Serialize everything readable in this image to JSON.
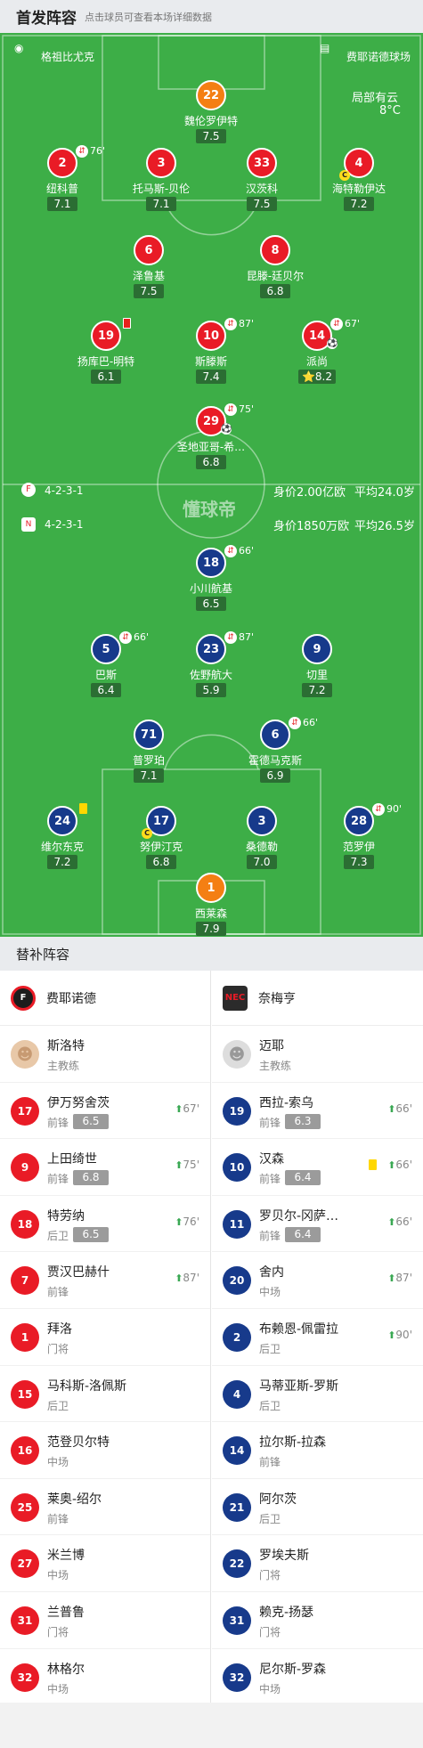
{
  "header": {
    "title": "首发阵容",
    "subtitle": "点击球员可查看本场详细数据"
  },
  "match": {
    "referee": "格祖比尤克",
    "stadium": "费耶诺德球场",
    "weather": "局部有云",
    "temperature": "8°C",
    "watermark": "懂球帝"
  },
  "home_team": {
    "name": "费耶诺德",
    "formation": "4-2-3-1",
    "value": "身价2.00亿欧",
    "avg_age": "平均24.0岁"
  },
  "away_team": {
    "name": "奈梅亨",
    "formation": "4-2-3-1",
    "value": "身价1850万欧",
    "avg_age": "平均26.5岁"
  },
  "home_players": [
    {
      "num": "22",
      "name": "魏伦罗伊特",
      "rating": "7.5",
      "color": "orange"
    },
    {
      "num": "2",
      "name": "纽科普",
      "rating": "7.1",
      "color": "red",
      "sub_min": "76'"
    },
    {
      "num": "3",
      "name": "托马斯-贝伦",
      "rating": "7.1",
      "color": "red"
    },
    {
      "num": "33",
      "name": "汉茨科",
      "rating": "7.5",
      "color": "red"
    },
    {
      "num": "4",
      "name": "海特勒伊达",
      "rating": "7.2",
      "color": "red",
      "captain": "C"
    },
    {
      "num": "6",
      "name": "泽鲁基",
      "rating": "7.5",
      "color": "red"
    },
    {
      "num": "8",
      "name": "昆滕-廷贝尔",
      "rating": "6.8",
      "color": "red"
    },
    {
      "num": "19",
      "name": "扬库巴-明特",
      "rating": "6.1",
      "color": "red",
      "red_card": true
    },
    {
      "num": "10",
      "name": "斯滕斯",
      "rating": "7.4",
      "color": "red",
      "sub_min": "87'"
    },
    {
      "num": "14",
      "name": "派尚",
      "rating": "8.2",
      "color": "red",
      "sub_min": "67'",
      "star": "⭐",
      "goal": "⚽"
    },
    {
      "num": "29",
      "name": "圣地亚哥-希…",
      "rating": "6.8",
      "color": "red",
      "sub_min": "75'",
      "goal": "⚽"
    }
  ],
  "away_players": [
    {
      "num": "18",
      "name": "小川航基",
      "rating": "6.5",
      "color": "blue",
      "sub_min": "66'"
    },
    {
      "num": "5",
      "name": "巴斯",
      "rating": "6.4",
      "color": "blue",
      "sub_min": "66'"
    },
    {
      "num": "23",
      "name": "佐野航大",
      "rating": "5.9",
      "color": "blue",
      "sub_min": "87'"
    },
    {
      "num": "9",
      "name": "切里",
      "rating": "7.2",
      "color": "blue"
    },
    {
      "num": "71",
      "name": "普罗珀",
      "rating": "7.1",
      "color": "blue"
    },
    {
      "num": "6",
      "name": "霍德马克斯",
      "rating": "6.9",
      "color": "blue",
      "sub_min": "66'"
    },
    {
      "num": "24",
      "name": "维尔东克",
      "rating": "7.2",
      "color": "blue",
      "yellow_card": true
    },
    {
      "num": "17",
      "name": "努伊汀克",
      "rating": "6.8",
      "color": "blue",
      "captain": "C"
    },
    {
      "num": "3",
      "name": "桑德勒",
      "rating": "7.0",
      "color": "blue"
    },
    {
      "num": "28",
      "name": "范罗伊",
      "rating": "7.3",
      "color": "blue",
      "sub_min": "90'"
    },
    {
      "num": "1",
      "name": "西莱森",
      "rating": "7.9",
      "color": "orange"
    }
  ],
  "subs_section": {
    "title": "替补阵容"
  },
  "home_subs": {
    "coach": {
      "name": "斯洛特",
      "role": "主教练"
    },
    "players": [
      {
        "num": "17",
        "name": "伊万努舍茨",
        "pos": "前锋",
        "rating": "6.5",
        "sub_in": "67'"
      },
      {
        "num": "9",
        "name": "上田绮世",
        "pos": "前锋",
        "rating": "6.8",
        "sub_in": "75'"
      },
      {
        "num": "18",
        "name": "特劳纳",
        "pos": "后卫",
        "rating": "6.5",
        "sub_in": "76'"
      },
      {
        "num": "7",
        "name": "贾汉巴赫什",
        "pos": "前锋",
        "sub_in": "87'"
      },
      {
        "num": "1",
        "name": "拜洛",
        "pos": "门将"
      },
      {
        "num": "15",
        "name": "马科斯-洛佩斯",
        "pos": "后卫"
      },
      {
        "num": "16",
        "name": "范登贝尔特",
        "pos": "中场"
      },
      {
        "num": "25",
        "name": "莱奥-绍尔",
        "pos": "前锋"
      },
      {
        "num": "27",
        "name": "米兰博",
        "pos": "中场"
      },
      {
        "num": "31",
        "name": "兰普鲁",
        "pos": "门将"
      },
      {
        "num": "32",
        "name": "林格尔",
        "pos": "中场"
      }
    ]
  },
  "away_subs": {
    "coach": {
      "name": "迈耶",
      "role": "主教练"
    },
    "players": [
      {
        "num": "19",
        "name": "西拉-索乌",
        "pos": "前锋",
        "rating": "6.3",
        "sub_in": "66'"
      },
      {
        "num": "10",
        "name": "汉森",
        "pos": "前锋",
        "rating": "6.4",
        "sub_in": "66'",
        "yellow_card": true
      },
      {
        "num": "11",
        "name": "罗贝尔-冈萨…",
        "pos": "前锋",
        "rating": "6.4",
        "sub_in": "66'"
      },
      {
        "num": "20",
        "name": "舍内",
        "pos": "中场",
        "sub_in": "87'"
      },
      {
        "num": "2",
        "name": "布赖恩-佩雷拉",
        "pos": "后卫",
        "sub_in": "90'"
      },
      {
        "num": "4",
        "name": "马蒂亚斯-罗斯",
        "pos": "后卫"
      },
      {
        "num": "14",
        "name": "拉尔斯-拉森",
        "pos": "前锋"
      },
      {
        "num": "21",
        "name": "阿尔茨",
        "pos": "后卫"
      },
      {
        "num": "22",
        "name": "罗埃夫斯",
        "pos": "门将"
      },
      {
        "num": "31",
        "name": "赖克-扬瑟",
        "pos": "门将"
      },
      {
        "num": "32",
        "name": "尼尔斯-罗森",
        "pos": "中场"
      }
    ]
  },
  "icons": {
    "sub_icon": "sub-arrow-icon",
    "up_arrow": "⬆"
  }
}
